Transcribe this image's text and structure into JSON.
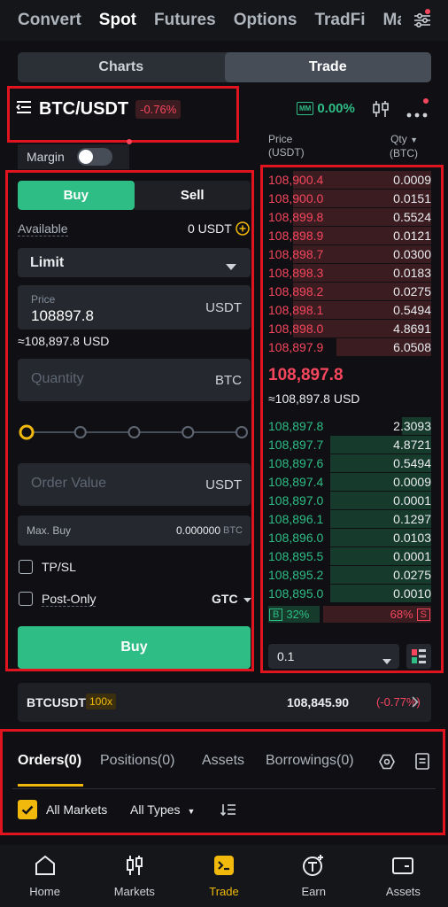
{
  "top_tabs": [
    "Convert",
    "Spot",
    "Futures",
    "Options",
    "TradFi",
    "Ma"
  ],
  "view_toggle": {
    "charts": "Charts",
    "trade": "Trade"
  },
  "pair": {
    "symbol": "BTC/USDT",
    "change": "-0.76%"
  },
  "mm": {
    "badge": "MM",
    "value": "0.00%"
  },
  "margin": {
    "label": "Margin"
  },
  "order_form": {
    "buy_tab": "Buy",
    "sell_tab": "Sell",
    "available_label": "Available",
    "available_value": "0 USDT",
    "order_type": "Limit",
    "price_label": "Price",
    "price_value": "108897.8",
    "price_unit": "USDT",
    "price_usd": "≈108,897.8 USD",
    "quantity_placeholder": "Quantity",
    "quantity_unit": "BTC",
    "slider_percent": 0,
    "order_value_placeholder": "Order Value",
    "order_value_unit": "USDT",
    "max_buy_label": "Max. Buy",
    "max_buy_value": "0.000000",
    "max_buy_unit": "BTC",
    "tpsl_label": "TP/SL",
    "postonly_label": "Post-Only",
    "tif": "GTC",
    "submit": "Buy"
  },
  "orderbook": {
    "price_header": "Price",
    "price_header_unit": "(USDT)",
    "qty_header": "Qty",
    "qty_header_unit": "(BTC)",
    "asks": [
      {
        "price": "108,900.4",
        "qty": "0.0009",
        "depth": 0.85
      },
      {
        "price": "108,900.0",
        "qty": "0.0151",
        "depth": 0.85
      },
      {
        "price": "108,899.8",
        "qty": "0.5524",
        "depth": 0.85
      },
      {
        "price": "108,898.9",
        "qty": "0.0121",
        "depth": 0.85
      },
      {
        "price": "108,898.7",
        "qty": "0.0300",
        "depth": 0.85
      },
      {
        "price": "108,898.3",
        "qty": "0.0183",
        "depth": 0.85
      },
      {
        "price": "108,898.2",
        "qty": "0.0275",
        "depth": 0.85
      },
      {
        "price": "108,898.1",
        "qty": "0.5494",
        "depth": 0.85
      },
      {
        "price": "108,898.0",
        "qty": "4.8691",
        "depth": 0.85
      },
      {
        "price": "108,897.9",
        "qty": "6.0508",
        "depth": 0.58
      }
    ],
    "mid_price": "108,897.8",
    "mid_usd": "≈108,897.8 USD",
    "bids": [
      {
        "price": "108,897.8",
        "qty": "2.3093",
        "depth": 0.18
      },
      {
        "price": "108,897.7",
        "qty": "4.8721",
        "depth": 0.62
      },
      {
        "price": "108,897.6",
        "qty": "0.5494",
        "depth": 0.62
      },
      {
        "price": "108,897.4",
        "qty": "0.0009",
        "depth": 0.62
      },
      {
        "price": "108,897.0",
        "qty": "0.0001",
        "depth": 0.62
      },
      {
        "price": "108,896.1",
        "qty": "0.1297",
        "depth": 0.62
      },
      {
        "price": "108,896.0",
        "qty": "0.0103",
        "depth": 0.62
      },
      {
        "price": "108,895.5",
        "qty": "0.0001",
        "depth": 0.62
      },
      {
        "price": "108,895.2",
        "qty": "0.0275",
        "depth": 0.62
      },
      {
        "price": "108,895.0",
        "qty": "0.0010",
        "depth": 0.62
      }
    ],
    "buy_badge": "B",
    "buy_pct": "32%",
    "sell_pct": "68%",
    "sell_badge": "S",
    "tick_size": "0.1"
  },
  "ticker": {
    "symbol": "BTCUSDT",
    "leverage": "100x",
    "price": "108,845.90",
    "change": "(-0.77%)"
  },
  "orders_tabs": [
    "Orders(0)",
    "Positions(0)",
    "Assets",
    "Borrowings(0)"
  ],
  "filters": {
    "all_markets": "All Markets",
    "all_types": "All Types"
  },
  "bottom_nav": [
    "Home",
    "Markets",
    "Trade",
    "Earn",
    "Assets"
  ],
  "colors": {
    "buy": "#2ebd85",
    "sell": "#f6465d",
    "accent": "#f0b90b",
    "annotation": "#e0141e"
  }
}
